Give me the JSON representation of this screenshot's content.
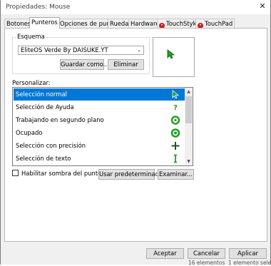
{
  "window": {
    "title": "Propiedades: Mouse",
    "close_glyph": "✕"
  },
  "tabs": [
    {
      "label": "Botones"
    },
    {
      "label": "Punteros"
    },
    {
      "label": "Opciones de puntero"
    },
    {
      "label": "Rueda"
    },
    {
      "label": "Hardware"
    },
    {
      "label": "TouchStyk",
      "icon": "touchstyk-icon"
    },
    {
      "label": "TouchPad",
      "icon": "touchpad-icon"
    }
  ],
  "scheme": {
    "label": "Esquema",
    "selected": "EliteOS Verde By DAISUKE.YT",
    "save_label": "Guardar como...",
    "delete_label": "Eliminar"
  },
  "customize": {
    "label": "Personalizar:",
    "items": [
      {
        "label": "Selección normal",
        "icon": "arrow-cursor-icon",
        "selected": true
      },
      {
        "label": "Selección de Ayuda",
        "icon": "help-cursor-icon"
      },
      {
        "label": "Trabajando en segundo plano",
        "icon": "working-cursor-icon"
      },
      {
        "label": "Ocupado",
        "icon": "busy-cursor-icon"
      },
      {
        "label": "Selección con precisión",
        "icon": "crosshair-cursor-icon"
      },
      {
        "label": "Selección de texto",
        "icon": "text-cursor-icon"
      }
    ]
  },
  "options": {
    "shadow_label": "Habilitar sombra del puntero",
    "default_label": "Usar predeterminado",
    "browse_label": "Examinar..."
  },
  "footer": {
    "ok_label": "Aceptar",
    "cancel_label": "Cancelar",
    "apply_label": "Aplicar"
  },
  "behind": {
    "text1": "16 elementos",
    "text2": "1 elemento selec"
  },
  "colors": {
    "accent": "#0078d7",
    "cursor_green": "#1ea21e"
  }
}
